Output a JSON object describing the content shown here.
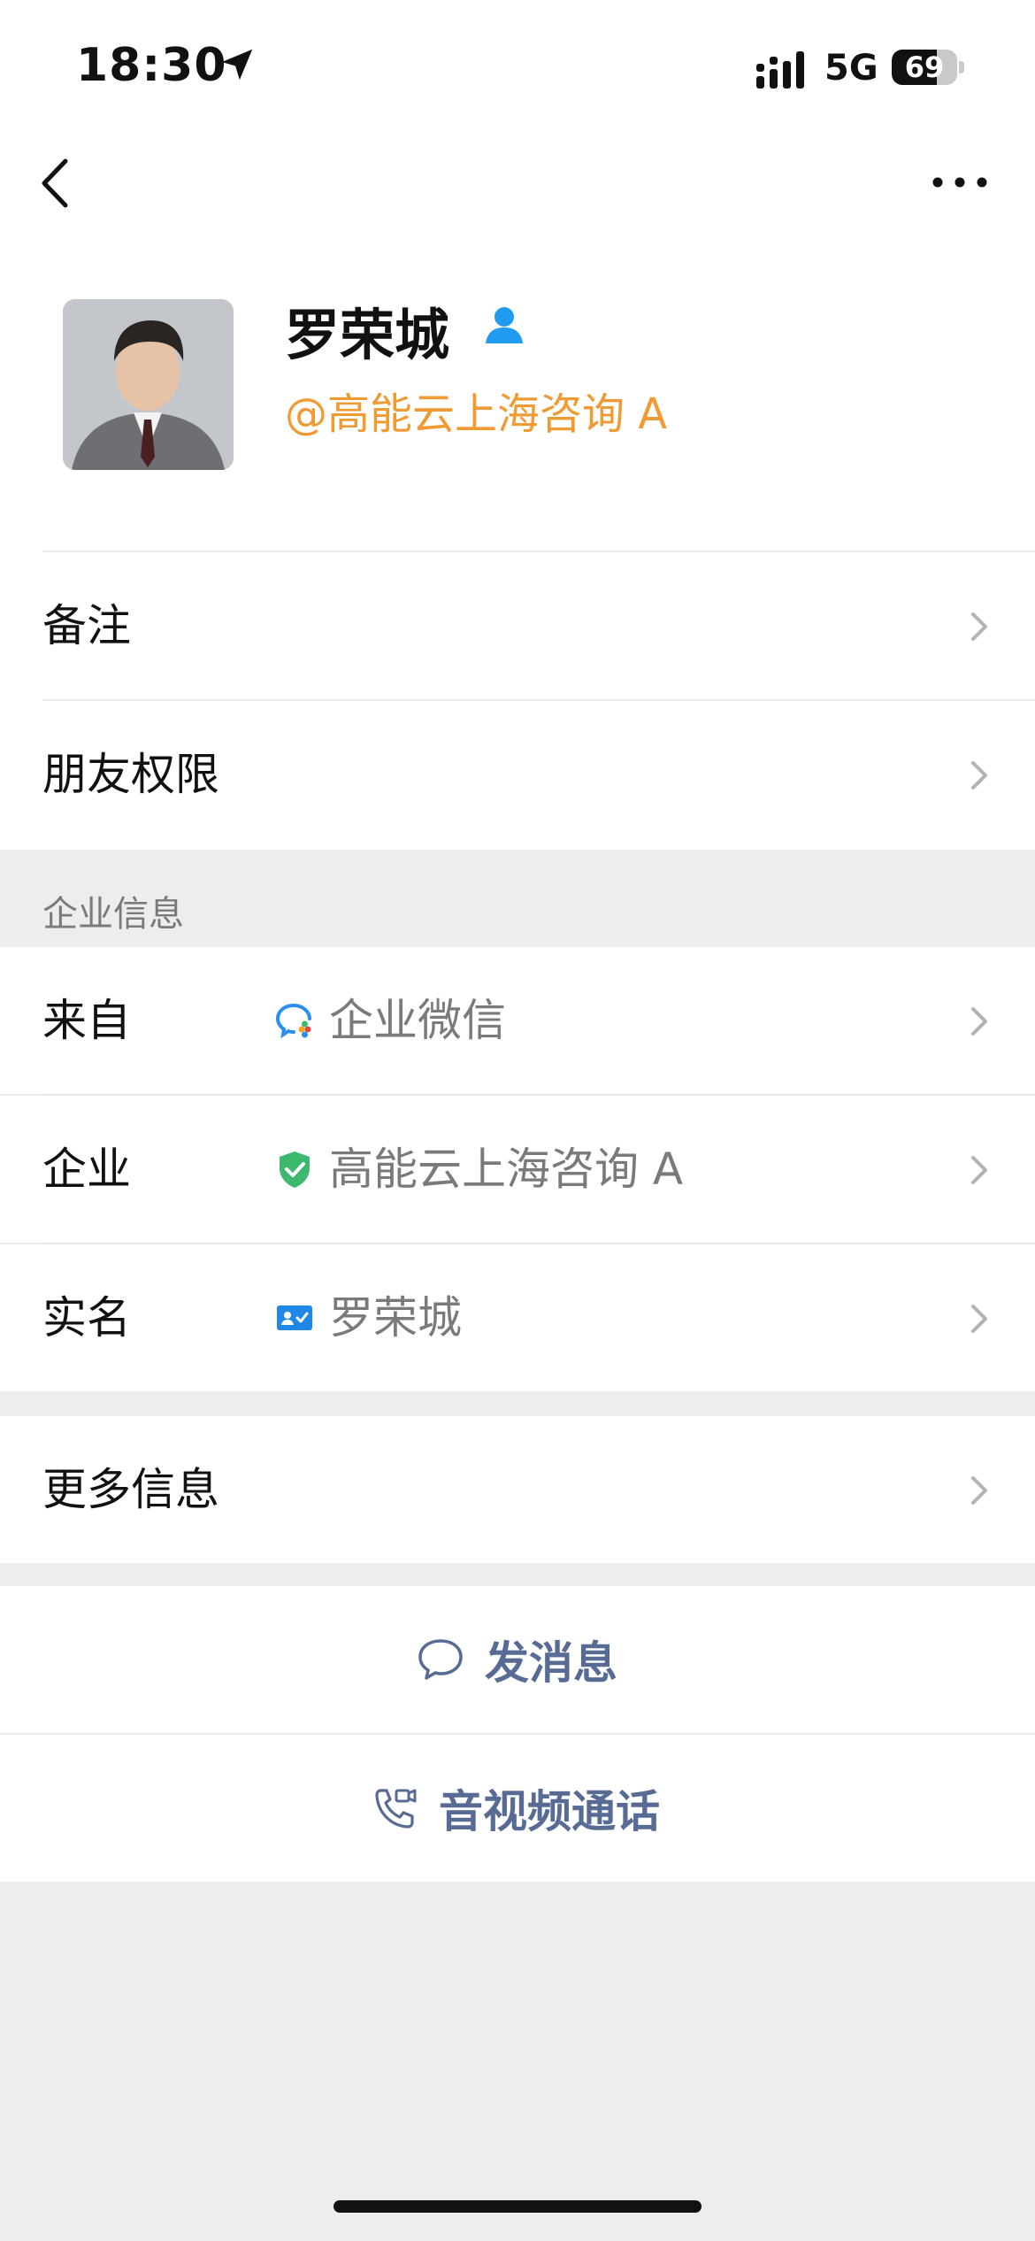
{
  "status": {
    "time": "18:30",
    "network": "5G",
    "battery": "69",
    "battery_level": 0.69
  },
  "profile": {
    "name": "罗荣城",
    "company_tag": "@高能云上海咨询 A"
  },
  "settings": {
    "remark": "备注",
    "friend_permission": "朋友权限"
  },
  "enterprise": {
    "section_title": "企业信息",
    "rows": [
      {
        "label": "来自",
        "value": "企业微信"
      },
      {
        "label": "企业",
        "value": "高能云上海咨询 A"
      },
      {
        "label": "实名",
        "value": "罗荣城"
      }
    ]
  },
  "more": {
    "label": "更多信息"
  },
  "actions": {
    "message": "发消息",
    "call": "音视频通话"
  },
  "colors": {
    "accent_orange": "#f09a34",
    "link_blue": "#576b95",
    "verified_green": "#3cb86f",
    "icon_blue": "#1f87e8"
  }
}
